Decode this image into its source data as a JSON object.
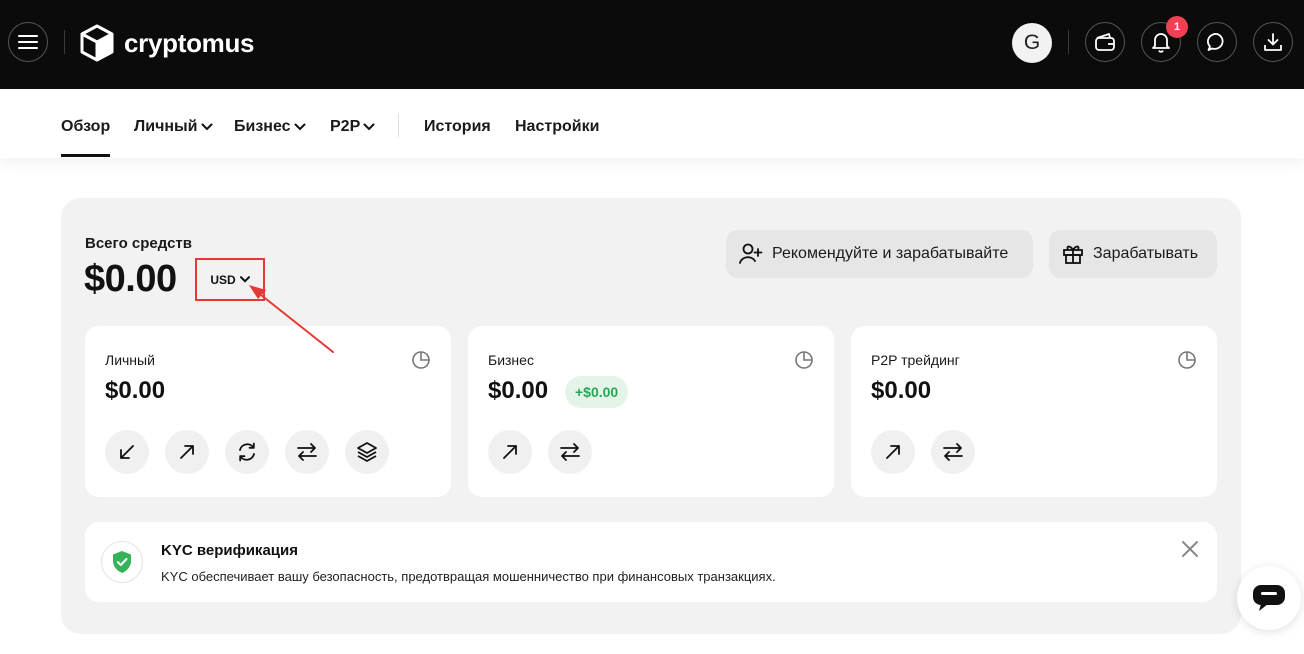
{
  "header": {
    "brand": "cryptomus",
    "avatar_letter": "G",
    "notification_count": "1",
    "icons": [
      "menu-icon",
      "cube-logo-icon",
      "wallet-icon",
      "bell-icon",
      "chat-icon",
      "download-icon"
    ]
  },
  "nav": {
    "items": [
      {
        "label": "Обзор",
        "active": true,
        "dropdown": false
      },
      {
        "label": "Личный",
        "dropdown": true
      },
      {
        "label": "Бизнес",
        "dropdown": true
      },
      {
        "label": "P2P",
        "dropdown": true
      },
      {
        "label": "История",
        "dropdown": false
      },
      {
        "label": "Настройки",
        "dropdown": false
      }
    ]
  },
  "balance": {
    "label": "Всего средств",
    "amount": "$0.00",
    "currency": "USD"
  },
  "actions": {
    "refer_label": "Рекомендуйте и зарабатывайте",
    "earn_label": "Зарабатывать"
  },
  "cards": [
    {
      "title": "Личный",
      "amount": "$0.00",
      "actions": [
        "arrow-down-left-icon",
        "arrow-up-right-icon",
        "refresh-icon",
        "transfer-icon",
        "layers-icon"
      ]
    },
    {
      "title": "Бизнес",
      "amount": "$0.00",
      "badge": "+$0.00",
      "actions": [
        "arrow-up-right-icon",
        "transfer-icon"
      ]
    },
    {
      "title": "P2P трейдинг",
      "amount": "$0.00",
      "actions": [
        "arrow-up-right-icon",
        "transfer-icon"
      ]
    }
  ],
  "kyc": {
    "title": "KYC верификация",
    "text": "KYC обеспечивает вашу безопасность, предотвращая мошенничество при финансовых транзакциях."
  },
  "colors": {
    "topbar": "#0b0b0b",
    "panel": "#f2f2f2",
    "badge_red": "#ef4152",
    "accent_green": "#2aa657",
    "annotation_red": "#e53935"
  }
}
